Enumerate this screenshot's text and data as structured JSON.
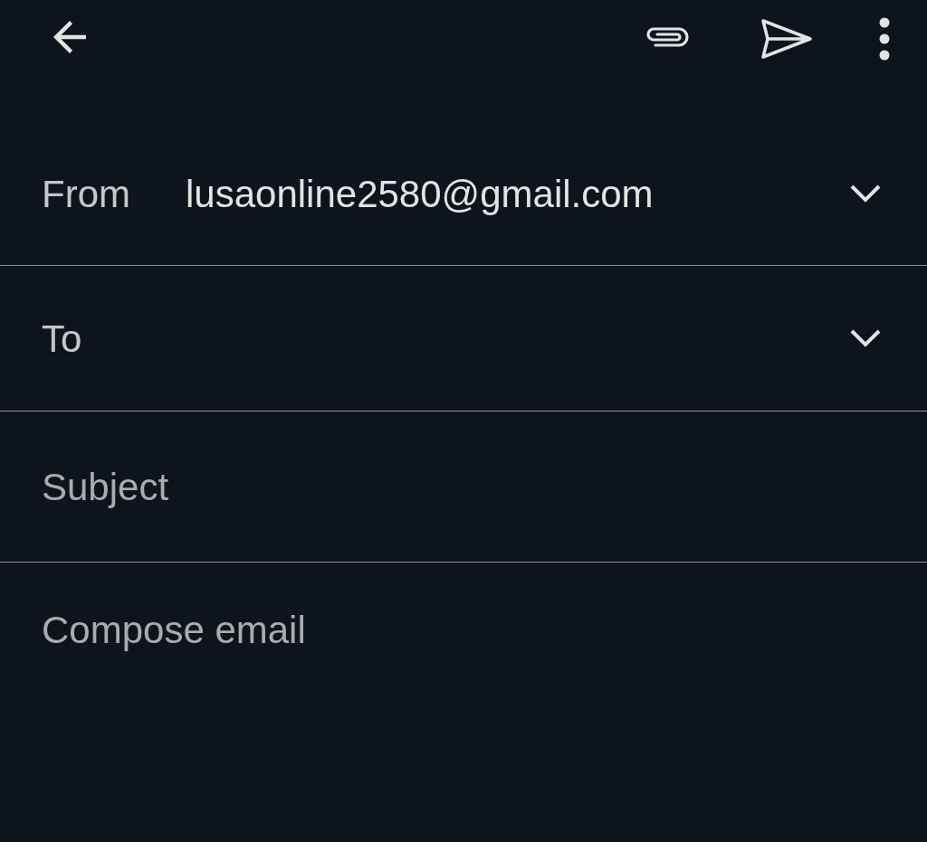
{
  "from": {
    "label": "From",
    "value": "lusaonline2580@gmail.com"
  },
  "to": {
    "label": "To"
  },
  "subject": {
    "placeholder": "Subject"
  },
  "body": {
    "placeholder": "Compose email"
  }
}
